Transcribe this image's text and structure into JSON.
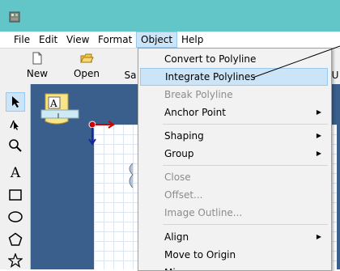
{
  "menubar": {
    "items": [
      "File",
      "Edit",
      "View",
      "Format",
      "Object",
      "Help"
    ]
  },
  "toolbar": {
    "new_label": "New",
    "open_label": "Open",
    "save_label": "Sa",
    "undo_label": "U"
  },
  "object_menu": {
    "items": [
      {
        "label": "Convert to Polyline"
      },
      {
        "label": "Integrate Polylines"
      },
      {
        "label": "Break Polyline"
      },
      {
        "label": "Anchor Point"
      },
      {
        "label": "Shaping"
      },
      {
        "label": "Group"
      },
      {
        "label": "Close"
      },
      {
        "label": "Offset..."
      },
      {
        "label": "Image Outline..."
      },
      {
        "label": "Align"
      },
      {
        "label": "Move to Origin"
      },
      {
        "label": "Mi"
      }
    ]
  },
  "toolbox": {
    "text_tool_label": "A"
  },
  "colors": {
    "titlebar": "#62c6c8",
    "workspace": "#3a5f8c",
    "highlight": "#cce4f7"
  }
}
